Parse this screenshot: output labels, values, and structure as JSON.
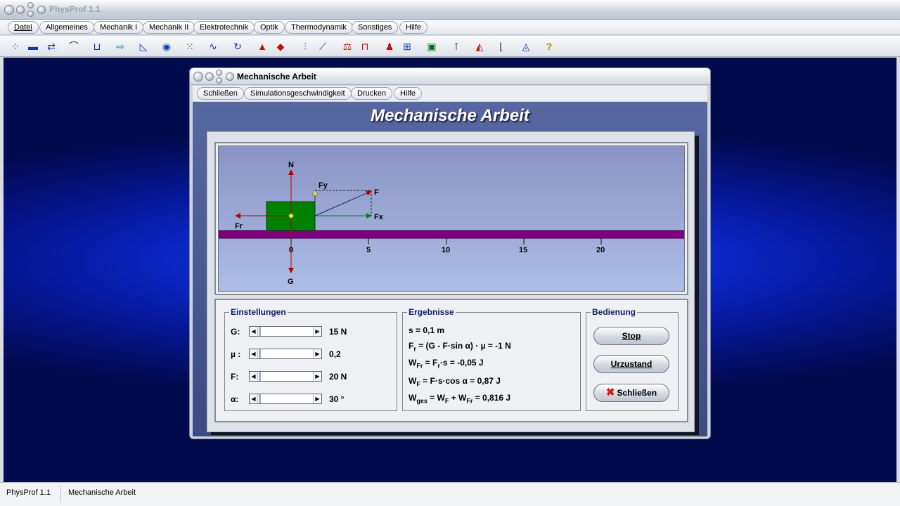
{
  "app": {
    "title": "PhysProf 1.1"
  },
  "menu": [
    {
      "label": "Datei"
    },
    {
      "label": "Allgemeines"
    },
    {
      "label": "Mechanik I"
    },
    {
      "label": "Mechanik II"
    },
    {
      "label": "Elektrotechnik"
    },
    {
      "label": "Optik"
    },
    {
      "label": "Thermodynamik"
    },
    {
      "label": "Sonstiges"
    },
    {
      "label": "Hilfe"
    }
  ],
  "toolbar": {
    "icons": [
      "atoms-icon",
      "conveyor-icon",
      "exchange-icon",
      "hill-icon",
      "cylinders-icon",
      "arrow-box-icon",
      "incline-icon",
      "eye-icon",
      "dots-icon",
      "wave-icon",
      "circle-arrow-icon",
      "magnet-icon",
      "rotate-icon",
      "coil-icon",
      "graph-icon",
      "balance-icon",
      "frame-icon",
      "people-icon",
      "circuit-icon",
      "battery-icon",
      "lens-icon",
      "prism-icon",
      "curve-icon",
      "spectrum-icon",
      "help-icon"
    ]
  },
  "child": {
    "title": "Mechanische Arbeit",
    "menu": [
      {
        "label": "Schließen"
      },
      {
        "label": "Simulationsgeschwindigkeit"
      },
      {
        "label": "Drucken"
      },
      {
        "label": "Hilfe"
      }
    ],
    "heading": "Mechanische Arbeit"
  },
  "sim": {
    "labels": {
      "N": "N",
      "G": "G",
      "Fr": "Fr",
      "F": "F",
      "Fy": "Fy",
      "Fx": "Fx"
    },
    "ticks": [
      "0",
      "5",
      "10",
      "15",
      "20"
    ],
    "colors": {
      "block": "#008000",
      "track": "#800080",
      "arrow": "#c00000"
    }
  },
  "settings": {
    "title": "Einstellungen",
    "rows": [
      {
        "label": "G:",
        "value": "15 N",
        "thumb": 0.0
      },
      {
        "label": "µ :",
        "value": "0,2",
        "thumb": 0.0
      },
      {
        "label": "F:",
        "value": "20 N",
        "thumb": 0.0
      },
      {
        "label": "α:",
        "value": "30 °",
        "thumb": 0.0
      }
    ]
  },
  "results": {
    "title": "Ergebnisse",
    "s": "s  =  0,1  m",
    "fr_sym": "F",
    "fr_sub": "r",
    "fr_rest": " =  (G  -  F·sin α) · µ  =  -1 N",
    "wfr_sym": "W",
    "wfr_sub": "Fr",
    "wfr_mid": " =  F",
    "wfr_sub2": "r",
    "wfr_rest": "·s  =  -0,05 J",
    "wf_sym": "W",
    "wf_sub": "F",
    "wf_rest": " =  F·s·cos α  =  0,87 J",
    "wges_sym": "W",
    "wges_sub": "ges",
    "wges_mid": " =  W",
    "wges_sub2": "F",
    "wges_plus": " + W",
    "wges_sub3": "Fr",
    "wges_rest": " = 0,816 J"
  },
  "controls": {
    "title": "Bedienung",
    "stop": "Stop",
    "reset": "Urzustand",
    "close": "Schließen"
  },
  "status": {
    "app": "PhysProf 1.1",
    "doc": "Mechanische Arbeit"
  }
}
